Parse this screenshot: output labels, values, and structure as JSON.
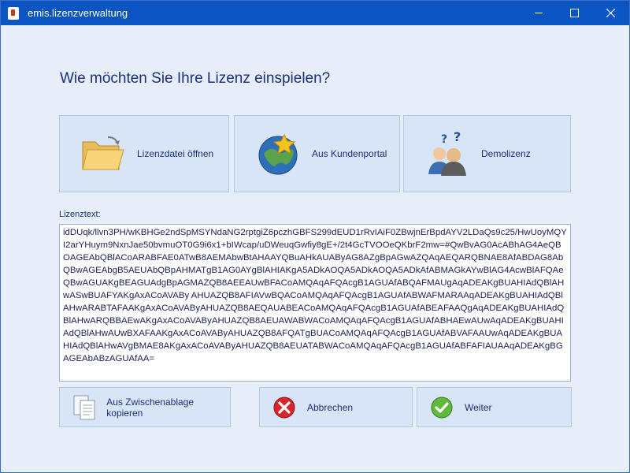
{
  "window": {
    "title": "emis.lizenzverwaltung"
  },
  "heading": "Wie möchten Sie Ihre Lizenz einspielen?",
  "options": {
    "file_label": "Lizenzdatei öffnen",
    "portal_label": "Aus Kundenportal",
    "demo_label": "Demolizenz"
  },
  "license": {
    "label": "Lizenztext:",
    "text": "idDUqk/llvn3PH/wKBHGe2ndSpMSYNdaNG2rptgiZ6pczhGBFS299dEUD1rRvIAiF0ZBwjnErBpdAYV2LDaQs9c25/HwUoyMQYI2arYHuym9NxnJae50bvmuOT0G9i6x1+bIWcap/uDWeuqGwfiy8gE+/2t4GcTVOOeQKbrF2mw=#QwBvAG0AcABhAG4AeQBOAGEAbQBlACoARABFAE0ATwB8AEMAbwBtAHAAYQBuAHkAUAByAG8AZgBpAGwAZQAqAEQARQBNAE8AfABDAG8AbQBwAGEAbgB5AEUAbQBpAHMATgB1AG0AYgBlAHIAKgA5ADkAOQA5ADkAOQA5ADkAfABMAGkAYwBlAG4AcwBlAFQAeQBwAGUAKgBEAGUAdgBpAGMAZQB8AEEAUwBFACoAMQAqAFQAcgB1AGUAfABQAFMAUgAqADEAKgBUAHIAdQBlAHwASwBUAFYAKgAxACoAVABy AHUAZQB8AFIAVwBQACoAMQAqAFQAcgB1AGUAfABWAFMARAAqADEAKgBUAHIAdQBlAHwARABTAFAAKgAxACoAVAByAHUAZQB8AEQAUABEACoAMQAqAFQAcgB1AGUAfABEAFAAQgAqADEAKgBUAHIAdQBlAHwARQBBAEwAKgAxACoAVAByAHUAZQB8AEUAWABWACoAMQAqAFQAcgB1AGUAfABHAEwAUwAqADEAKgBUAHIAdQBlAHwAUwBXAFAAKgAxACoAVAByAHUAZQB8AFQATgBUACoAMQAqAFQAcgB1AGUAfABVAFAAUwAqADEAKgBUAHIAdQBlAHwAVgBMAE8AKgAxACoAVAByAHUAZQB8AEUATABWACoAMQAqAFQAcgB1AGUAfABFAFIAUAAqADEAKgBGAGEAbABzAGUAfAA="
  },
  "buttons": {
    "clipboard_label": "Aus Zwischenablage kopieren",
    "cancel_label": "Abbrechen",
    "next_label": "Weiter"
  },
  "icons": {
    "folder": "folder-open-icon",
    "portal": "globe-star-icon",
    "demo": "users-question-icon",
    "clipboard": "clipboard-icon",
    "cancel": "cancel-icon",
    "next": "checkmark-icon"
  },
  "colors": {
    "titlebar": "#0b55c2",
    "background": "#e6eef9",
    "text": "#1d2e7a"
  }
}
